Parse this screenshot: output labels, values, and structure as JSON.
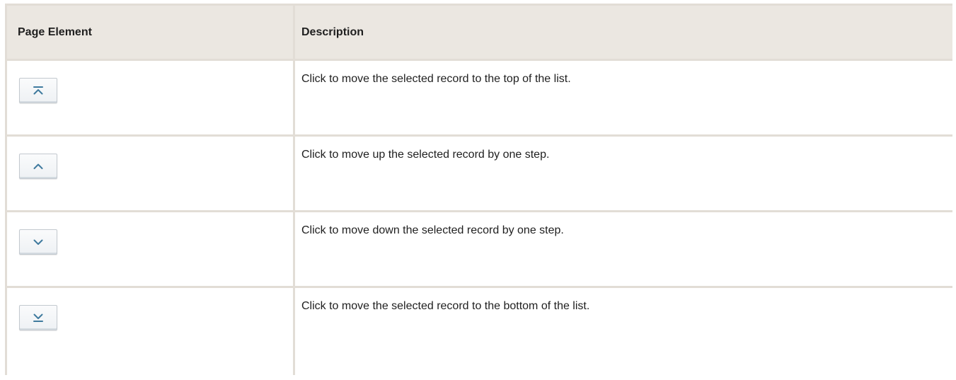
{
  "table": {
    "headers": {
      "element": "Page Element",
      "description": "Description"
    },
    "rows": [
      {
        "icon": "move-to-top-icon",
        "description": "Click to move the selected record to the top of the list."
      },
      {
        "icon": "move-up-icon",
        "description": "Click to move up the selected record by one step."
      },
      {
        "icon": "move-down-icon",
        "description": "Click to move down the selected record by one step."
      },
      {
        "icon": "move-to-bottom-icon",
        "description": "Click to move the selected record to the bottom of the list."
      }
    ]
  },
  "colors": {
    "icon": "#3f7a9e",
    "header_bg": "#ebe7e1",
    "grid_lines": "#e2ddd6"
  }
}
